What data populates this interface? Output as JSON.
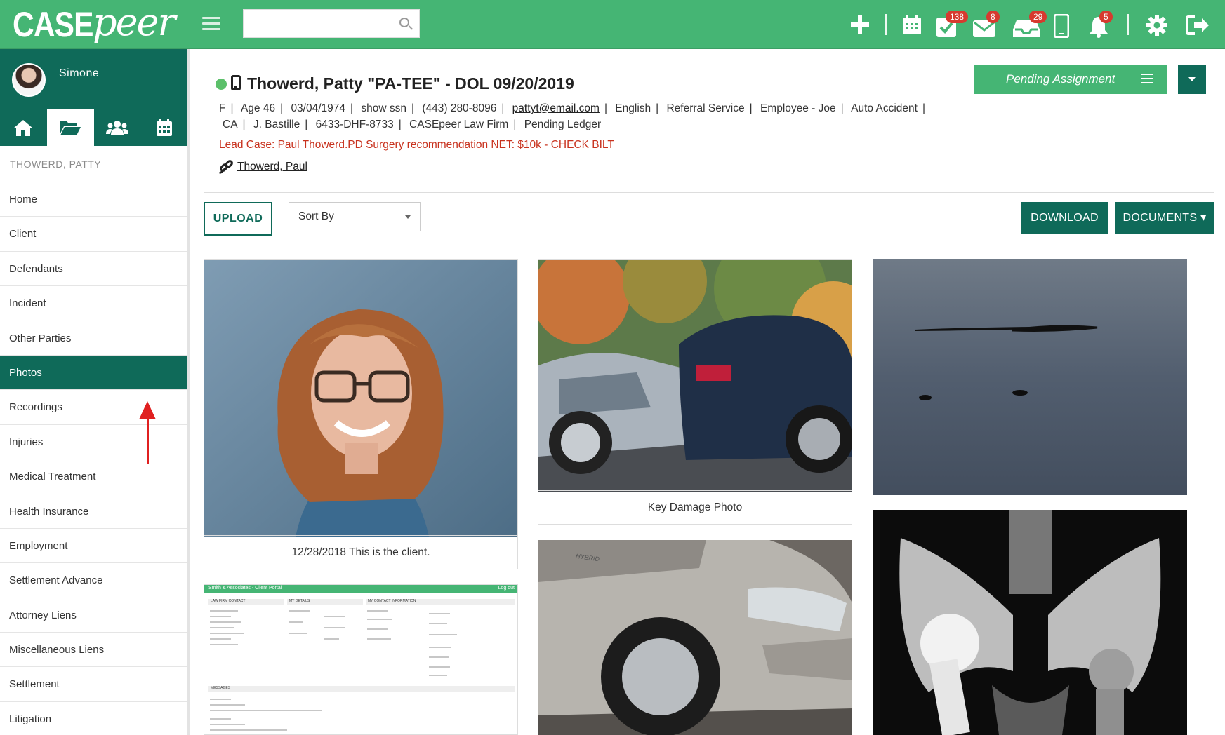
{
  "app": {
    "logo_case": "CASE",
    "logo_peer": "peer"
  },
  "topbar": {
    "search_placeholder": "",
    "badges": {
      "tasks": "138",
      "messages": "8",
      "inbox": "29",
      "notifications": "5"
    }
  },
  "user": {
    "name": "Simone"
  },
  "sidebar": {
    "case_name": "THOWERD, PATTY",
    "items": [
      "Home",
      "Client",
      "Defendants",
      "Incident",
      "Other Parties",
      "Photos",
      "Recordings",
      "Injuries",
      "Medical Treatment",
      "Health Insurance",
      "Employment",
      "Settlement Advance",
      "Attorney Liens",
      "Miscellaneous Liens",
      "Settlement",
      "Litigation"
    ],
    "active": "Photos"
  },
  "case": {
    "title": "Thowerd, Patty \"PA-TEE\" - DOL 09/20/2019",
    "line1": [
      "F",
      "Age 46",
      "03/04/1974",
      "show ssn",
      "(443) 280-8096",
      "pattyt@email.com",
      "English",
      "Referral Service",
      "Employee - Joe",
      "Auto Accident"
    ],
    "line2": [
      "CA",
      "J. Bastille",
      "6433-DHF-8733",
      "CASEpeer Law Firm",
      "Pending Ledger"
    ],
    "lead": "Lead Case: Paul Thowerd.PD Surgery recommendation NET: $10k - CHECK BILT",
    "related": "Thowerd, Paul",
    "status": "Pending Assignment"
  },
  "toolbar": {
    "upload": "UPLOAD",
    "sort": "Sort By",
    "download": "DOWNLOAD",
    "documents": "DOCUMENTS ▾"
  },
  "photos": {
    "p1_caption": "12/28/2018 This is the client.",
    "p2_caption": "Key Damage Photo",
    "portal_title": "Smith & Associates - Client Portal",
    "portal_logout": "Log out",
    "portal_cols": [
      "LAW FIRM CONTACT",
      "MY DETAILS",
      "MY CONTACT INFORMATION"
    ],
    "portal_messages": "MESSAGES",
    "suv_badge": "HYBRID"
  },
  "colors": {
    "brand_green": "#45b574",
    "dark_teal": "#0f6a59",
    "alert_red": "#d63a2f"
  }
}
